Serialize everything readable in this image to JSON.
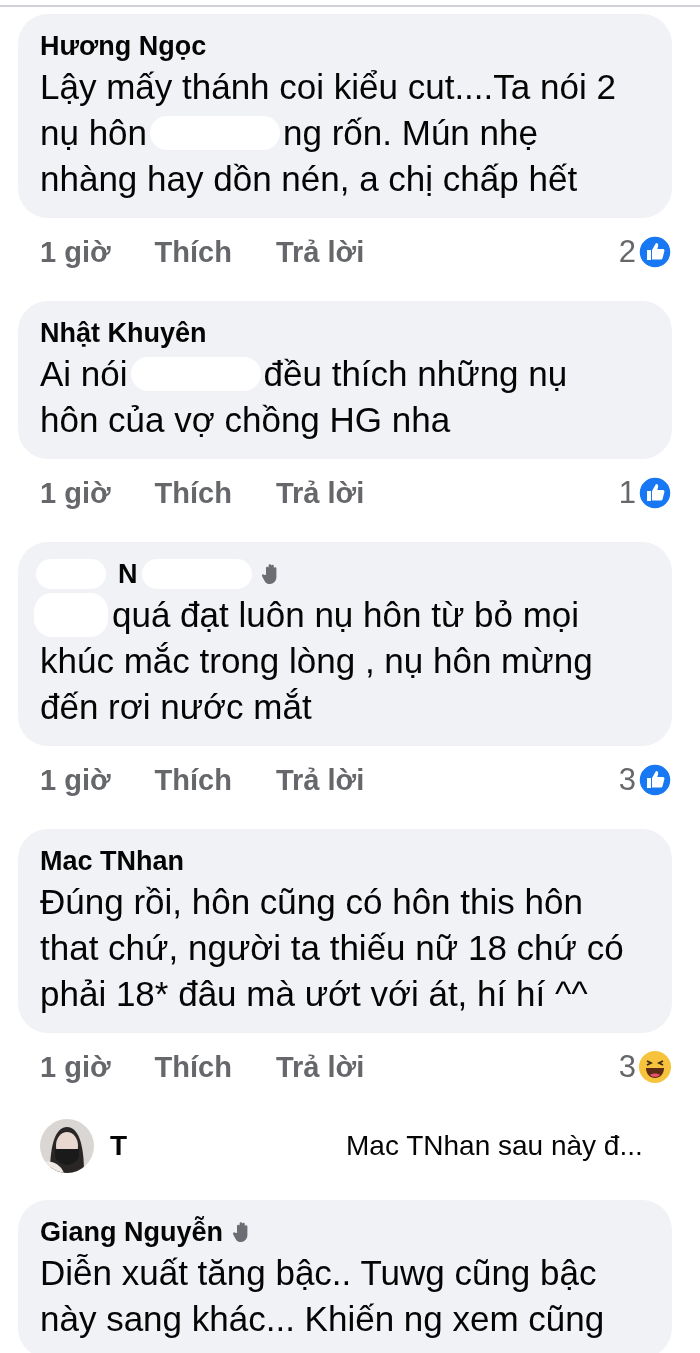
{
  "items": [
    {
      "kind": "comment",
      "author": [
        {
          "kind": "text",
          "text": "Hương Ngọc"
        }
      ],
      "lines": [
        [
          {
            "kind": "text",
            "text": "Lậy mấy thánh coi kiểu cut....Ta nói 2"
          }
        ],
        [
          {
            "kind": "text",
            "text": "nụ hôn"
          },
          {
            "kind": "redaction"
          },
          {
            "kind": "text",
            "text": "ng rốn. Mún nhẹ"
          }
        ],
        [
          {
            "kind": "text",
            "text": "nhàng hay dồn nén, a chị chấp hết"
          }
        ]
      ],
      "time": "1 giờ",
      "like": "Thích",
      "reply": "Trả lời",
      "reaction": {
        "kind": "like",
        "count": "2"
      }
    },
    {
      "kind": "comment",
      "author": [
        {
          "kind": "text",
          "text": "Nhật Khuyên"
        }
      ],
      "lines": [
        [
          {
            "kind": "text",
            "text": "Ai nói"
          },
          {
            "kind": "redaction"
          },
          {
            "kind": "text",
            "text": "đều thích những nụ"
          }
        ],
        [
          {
            "kind": "text",
            "text": "hôn của vợ chồng HG nha"
          }
        ]
      ],
      "time": "1 giờ",
      "like": "Thích",
      "reply": "Trả lời",
      "reaction": {
        "kind": "like",
        "count": "1"
      }
    },
    {
      "kind": "comment",
      "author": [
        {
          "kind": "redaction"
        },
        {
          "kind": "text",
          "text": "N"
        },
        {
          "kind": "redaction"
        },
        {
          "kind": "badge"
        }
      ],
      "lines": [
        [
          {
            "kind": "redaction"
          },
          {
            "kind": "text",
            "text": "quá đạt luôn nụ hôn từ bỏ mọi"
          }
        ],
        [
          {
            "kind": "text",
            "text": "khúc mắc trong lòng , nụ hôn mừng"
          }
        ],
        [
          {
            "kind": "text",
            "text": "đến rơi nước mắt"
          }
        ]
      ],
      "time": "1 giờ",
      "like": "Thích",
      "reply": "Trả lời",
      "reaction": {
        "kind": "like",
        "count": "3"
      }
    },
    {
      "kind": "comment",
      "author": [
        {
          "kind": "text",
          "text": "Mac TNhan"
        }
      ],
      "lines": [
        [
          {
            "kind": "text",
            "text": "Đúng rồi, hôn cũng có hôn this hôn"
          }
        ],
        [
          {
            "kind": "text",
            "text": "that chứ, người ta thiếu nữ 18 chứ có"
          }
        ],
        [
          {
            "kind": "text",
            "text": "phải 18* đâu mà ướt với át, hí hí ^^"
          }
        ]
      ],
      "time": "1 giờ",
      "like": "Thích",
      "reply": "Trả lời",
      "reaction": {
        "kind": "haha",
        "count": "3"
      }
    },
    {
      "kind": "reply_preview",
      "author": "T",
      "text": "Mac TNhan sau này đ..."
    },
    {
      "kind": "comment",
      "author": [
        {
          "kind": "text",
          "text": "Giang Nguyễn"
        },
        {
          "kind": "badge"
        }
      ],
      "lines": [
        [
          {
            "kind": "text",
            "text": "Diễn xuất tăng bậc.. Tuwg cũng bậc"
          }
        ],
        [
          {
            "kind": "text",
            "text": "này sang khác... Khiến ng xem cũng"
          }
        ]
      ]
    }
  ]
}
